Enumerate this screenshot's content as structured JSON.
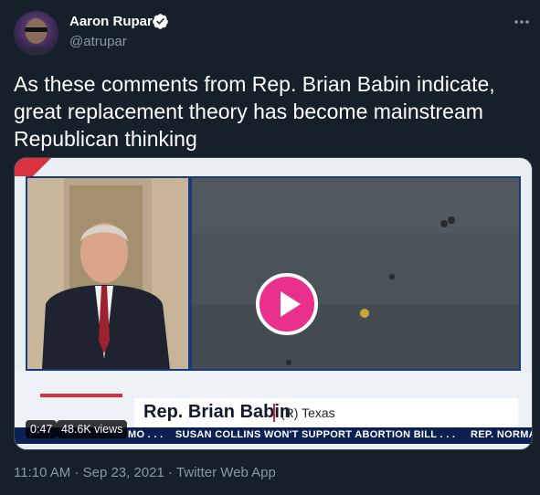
{
  "author": {
    "name": "Aaron Rupar",
    "handle": "@atrupar",
    "verified": true
  },
  "tweet": {
    "text": "As these comments from Rep. Brian Babin indicate, great replacement theory has become mainstream Republican thinking"
  },
  "video": {
    "chyron_name": "Rep. Brian Babin",
    "chyron_party": "(R) Texas",
    "ticker": "MO . . .    SUSAN COLLINS WON'T SUPPORT ABORTION BILL . . .     REP. NORMAN: BID",
    "time": "0:47",
    "views": "48.6K views"
  },
  "meta": {
    "timestamp": "11:10 AM · Sep 23, 2021 · Twitter Web App"
  },
  "colors": {
    "background": "#15202b",
    "secondary_text": "#8899a6",
    "play_button": "#e8308c",
    "verified": "#ffffff"
  },
  "icons": {
    "verified": "verified-badge-icon",
    "more": "more-options-icon",
    "play": "play-icon"
  }
}
